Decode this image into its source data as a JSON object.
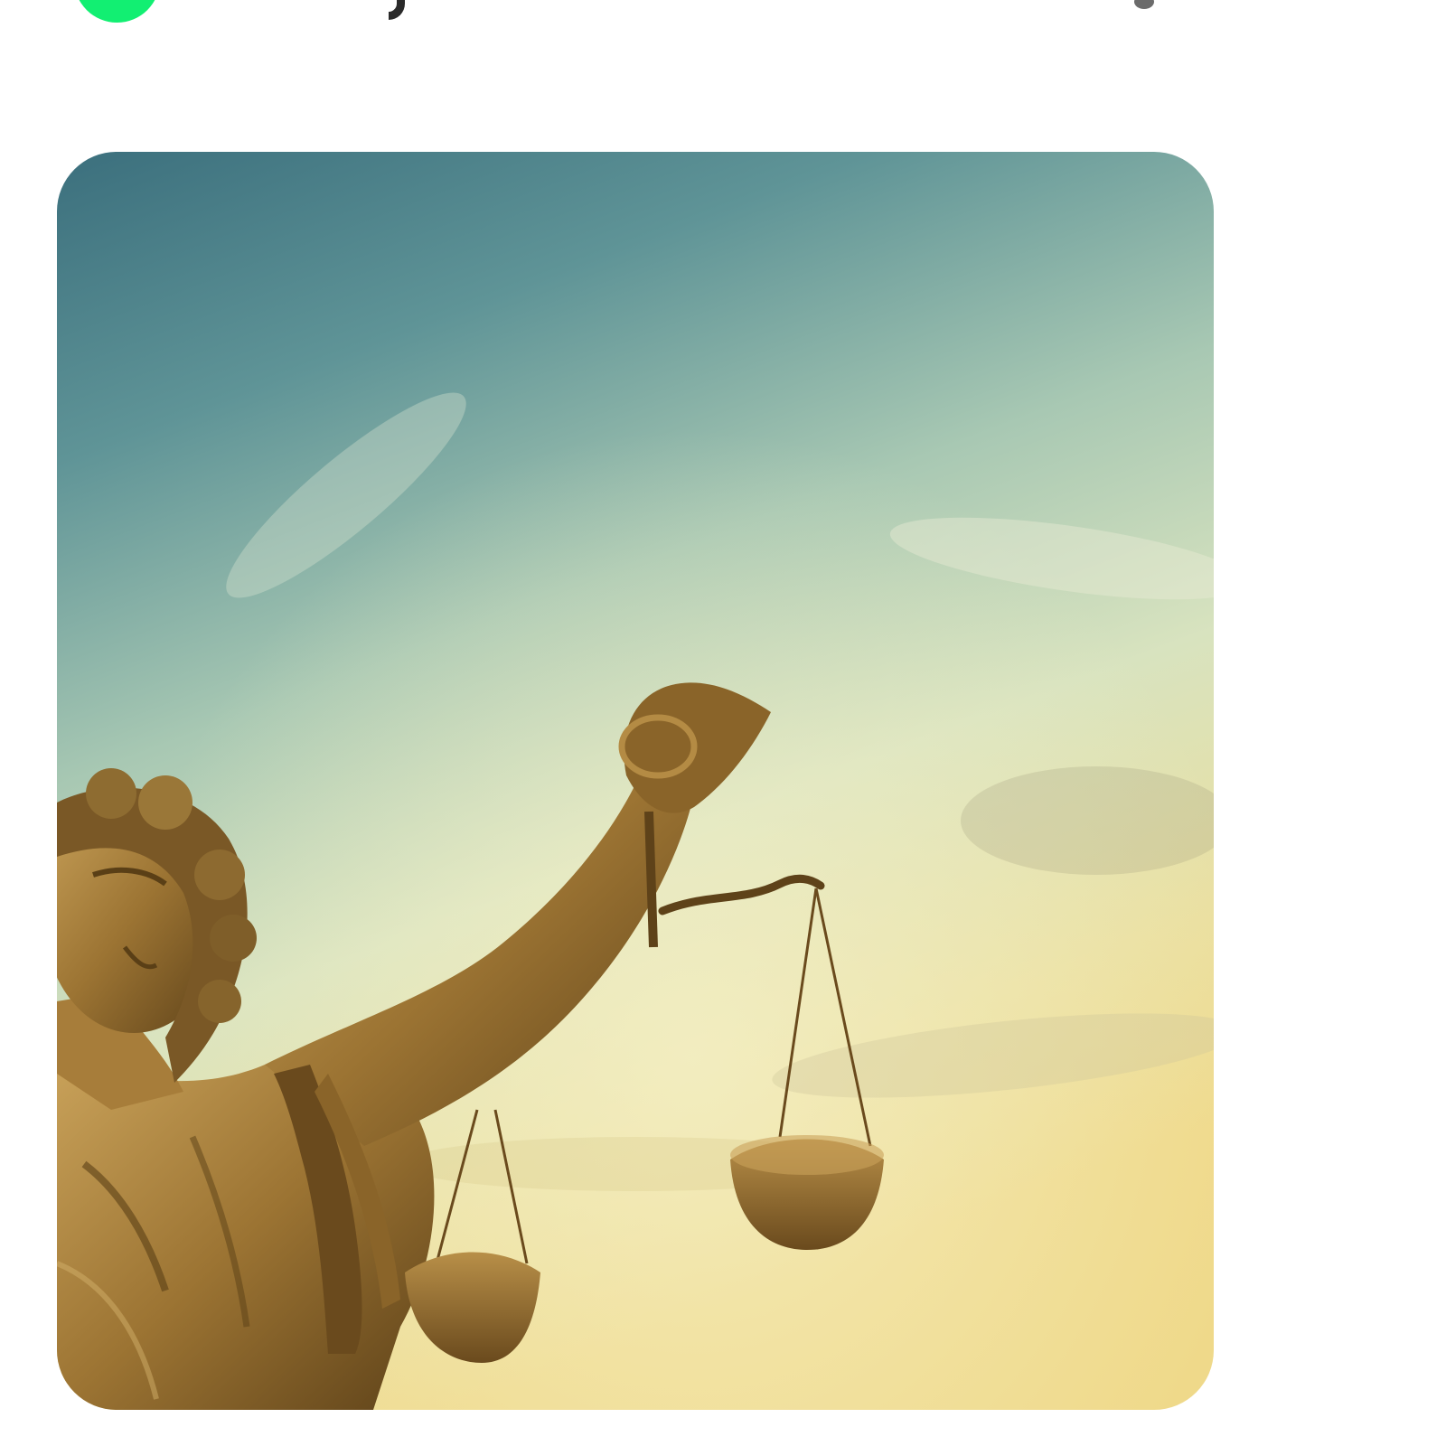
{
  "status": {
    "online_color": "#12ef72"
  },
  "message": {
    "image": {
      "subject": "lady-justice-statue",
      "colors": {
        "sky_top": "#3e7682",
        "sky_mid": "#a9c7b4",
        "sky_bottom": "#ecdd9c",
        "bronze": "#9c7433"
      }
    }
  }
}
